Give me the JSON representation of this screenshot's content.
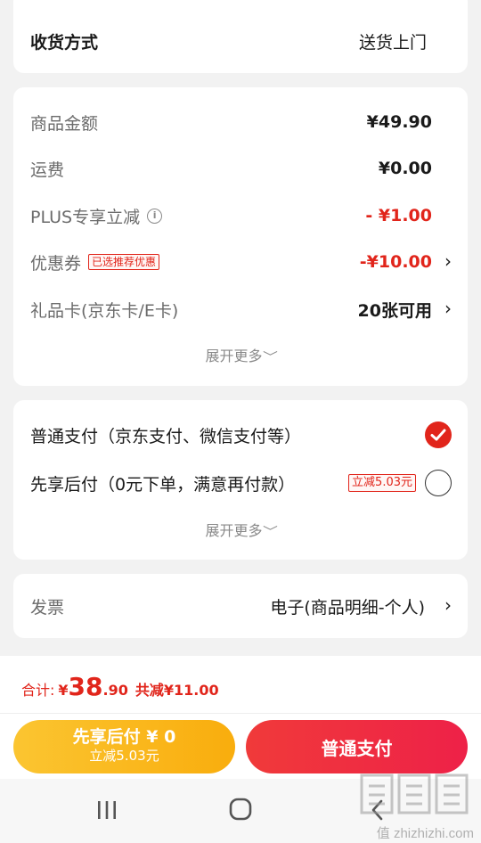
{
  "delivery": {
    "label": "收货方式",
    "value": "送货上门"
  },
  "summary": {
    "goods_amount_label": "商品金额",
    "goods_amount": "¥49.90",
    "shipping_label": "运费",
    "shipping": "¥0.00",
    "plus_label": "PLUS专享立减",
    "plus_info_icon": "i",
    "plus": "- ¥1.00",
    "coupon_label": "优惠券",
    "coupon_tag": "已选推荐优惠",
    "coupon": "-¥10.00",
    "giftcard_label": "礼品卡(京东卡/E卡)",
    "giftcard": "20张可用",
    "expand_more": "展开更多"
  },
  "payment": {
    "options": [
      {
        "label": "普通支付（京东支付、微信支付等）",
        "selected": true
      },
      {
        "label": "先享后付（0元下单，满意再付款）",
        "tag": "立减5.03元",
        "selected": false
      }
    ],
    "expand_more": "展开更多"
  },
  "invoice": {
    "label": "发票",
    "value": "电子(商品明细-个人)"
  },
  "total": {
    "label": "合计:",
    "currency": "¥",
    "integer": "38",
    "decimal": ".90",
    "discount": "共减¥11.00"
  },
  "buttons": {
    "pay_later": "先享后付 ¥ 0",
    "pay_later_sub": "立减5.03元",
    "pay_now": "普通支付"
  },
  "colors": {
    "accent": "#e1251b",
    "pay_later_bg": "#fbb514",
    "pay_now_bg": "#ee2a2a"
  },
  "watermark": "值 zhizhizhi.com"
}
